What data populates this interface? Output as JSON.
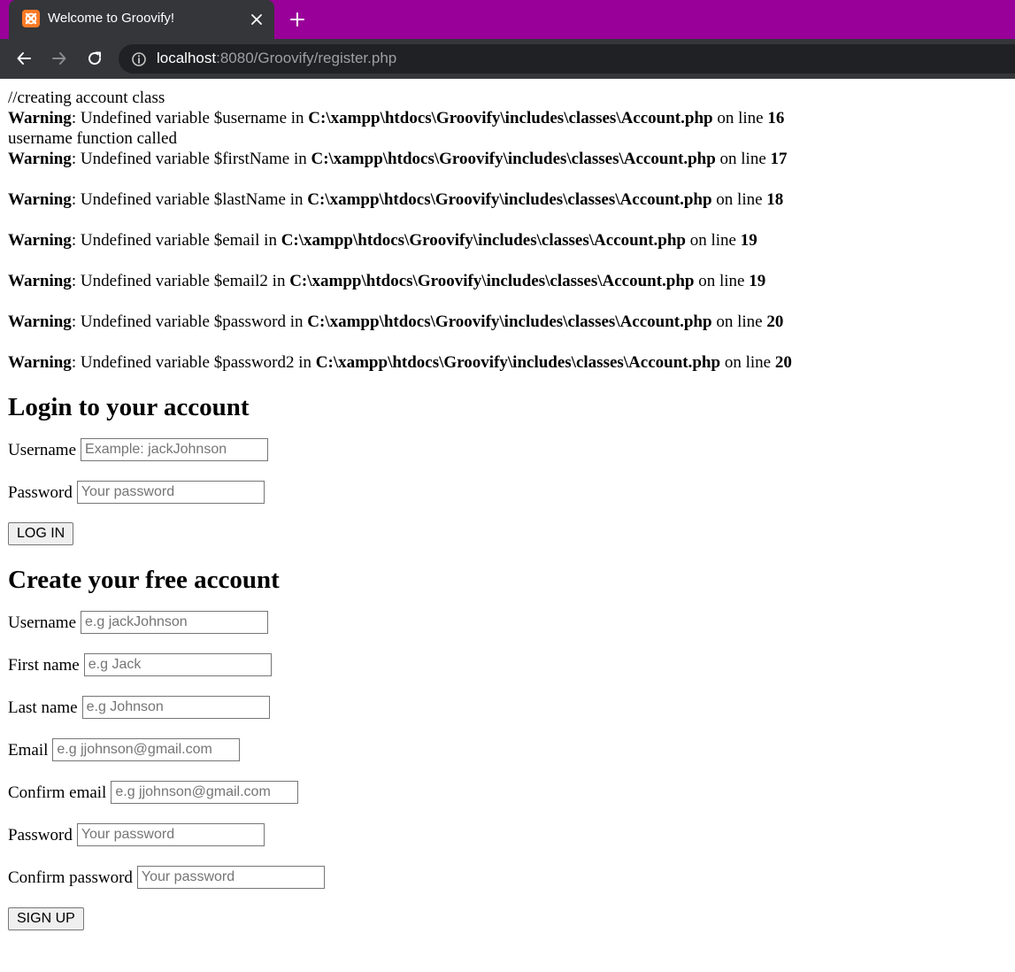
{
  "browser": {
    "tab_title": "Welcome to Groovify!",
    "url_host": "localhost",
    "url_path": ":8080/Groovify/register.php",
    "colors": {
      "tabstrip": "#990099",
      "toolbar": "#35363a",
      "omnibox": "#202124",
      "favicon": "#fb7a24"
    }
  },
  "debug": {
    "line1": "//creating account class",
    "line2": "username function called"
  },
  "warnings": [
    {
      "label": "Warning",
      "msg": ": Undefined variable $username in ",
      "path": "C:\\xampp\\htdocs\\Groovify\\includes\\classes\\Account.php",
      "online": " on line ",
      "line": "16"
    },
    {
      "label": "Warning",
      "msg": ": Undefined variable $firstName in ",
      "path": "C:\\xampp\\htdocs\\Groovify\\includes\\classes\\Account.php",
      "online": " on line ",
      "line": "17"
    },
    {
      "label": "Warning",
      "msg": ": Undefined variable $lastName in ",
      "path": "C:\\xampp\\htdocs\\Groovify\\includes\\classes\\Account.php",
      "online": " on line ",
      "line": "18"
    },
    {
      "label": "Warning",
      "msg": ": Undefined variable $email in ",
      "path": "C:\\xampp\\htdocs\\Groovify\\includes\\classes\\Account.php",
      "online": " on line ",
      "line": "19"
    },
    {
      "label": "Warning",
      "msg": ": Undefined variable $email2 in ",
      "path": "C:\\xampp\\htdocs\\Groovify\\includes\\classes\\Account.php",
      "online": " on line ",
      "line": "19"
    },
    {
      "label": "Warning",
      "msg": ": Undefined variable $password in ",
      "path": "C:\\xampp\\htdocs\\Groovify\\includes\\classes\\Account.php",
      "online": " on line ",
      "line": "20"
    },
    {
      "label": "Warning",
      "msg": ": Undefined variable $password2 in ",
      "path": "C:\\xampp\\htdocs\\Groovify\\includes\\classes\\Account.php",
      "online": " on line ",
      "line": "20"
    }
  ],
  "login": {
    "heading": "Login to your account",
    "username_label": "Username",
    "username_placeholder": "Example: jackJohnson",
    "password_label": "Password",
    "password_placeholder": "Your password",
    "button": "LOG IN"
  },
  "register": {
    "heading": "Create your free account",
    "username_label": "Username",
    "username_placeholder": "e.g jackJohnson",
    "firstname_label": "First name",
    "firstname_placeholder": "e.g Jack",
    "lastname_label": "Last name",
    "lastname_placeholder": "e.g Johnson",
    "email_label": "Email",
    "email_placeholder": "e.g jjohnson@gmail.com",
    "email2_label": "Confirm email",
    "email2_placeholder": "e.g jjohnson@gmail.com",
    "password_label": "Password",
    "password_placeholder": "Your password",
    "password2_label": "Confirm password",
    "password2_placeholder": "Your password",
    "button": "SIGN UP"
  }
}
